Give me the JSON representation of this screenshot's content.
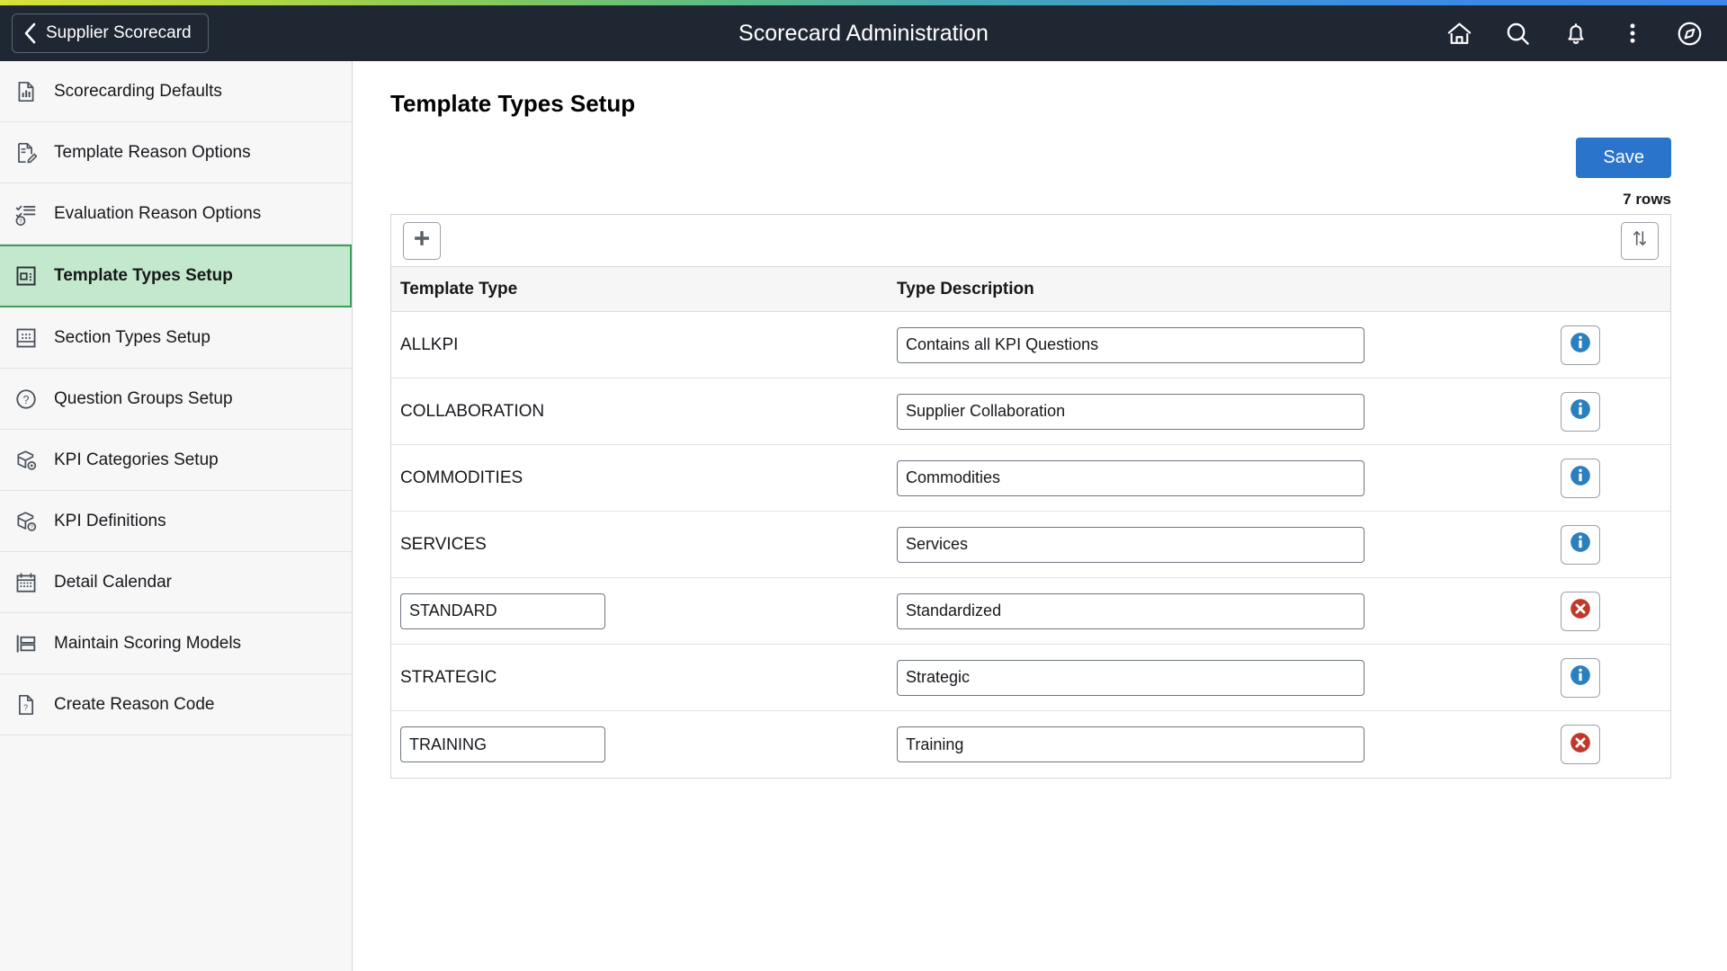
{
  "top_strip": {
    "gradient_from": "#d8e23a",
    "gradient_to": "#3f86ea"
  },
  "header": {
    "back_label": "Supplier Scorecard",
    "title": "Scorecard Administration",
    "background": "#1f2733",
    "icons": [
      {
        "name": "home-icon"
      },
      {
        "name": "search-icon"
      },
      {
        "name": "notifications-bell-icon"
      },
      {
        "name": "actions-menu-icon"
      },
      {
        "name": "navigator-compass-icon"
      }
    ]
  },
  "sidebar": {
    "selected_index": 3,
    "selected_background": "#c4e8cd",
    "selected_border": "#3f9e5c",
    "items": [
      {
        "label": "Scorecarding Defaults",
        "icon": "document-chart-icon"
      },
      {
        "label": "Template Reason Options",
        "icon": "document-edit-icon"
      },
      {
        "label": "Evaluation Reason Options",
        "icon": "checklist-question-icon"
      },
      {
        "label": "Template Types Setup",
        "icon": "template-grid-icon"
      },
      {
        "label": "Section Types Setup",
        "icon": "section-dots-icon"
      },
      {
        "label": "Question Groups Setup",
        "icon": "question-circle-icon"
      },
      {
        "label": "KPI Categories Setup",
        "icon": "cube-gear-icon"
      },
      {
        "label": "KPI Definitions",
        "icon": "cube-question-icon"
      },
      {
        "label": "Detail Calendar",
        "icon": "calendar-icon"
      },
      {
        "label": "Maintain Scoring Models",
        "icon": "scoring-model-icon"
      },
      {
        "label": "Create Reason Code",
        "icon": "document-question-icon"
      }
    ]
  },
  "main": {
    "page_title": "Template Types Setup",
    "save_label": "Save",
    "save_color": "#2a74cc",
    "rows_count_label": "7 rows",
    "toolbar": {
      "add_row_icon": "plus-icon",
      "sort_icon": "sort-arrows-icon"
    },
    "grid": {
      "columns": [
        {
          "key": "template_type",
          "label": "Template Type"
        },
        {
          "key": "type_description",
          "label": "Type Description"
        }
      ],
      "info_color": "#2a7fbf",
      "delete_color": "#c0392b",
      "rows": [
        {
          "template_type": "ALLKPI",
          "type_editable": false,
          "type_description": "Contains all KPI Questions",
          "action": "info",
          "action_icon": "info-icon"
        },
        {
          "template_type": "COLLABORATION",
          "type_editable": false,
          "type_description": "Supplier Collaboration",
          "action": "info",
          "action_icon": "info-icon"
        },
        {
          "template_type": "COMMODITIES",
          "type_editable": false,
          "type_description": "Commodities",
          "action": "info",
          "action_icon": "info-icon"
        },
        {
          "template_type": "SERVICES",
          "type_editable": false,
          "type_description": "Services",
          "action": "info",
          "action_icon": "info-icon"
        },
        {
          "template_type": "STANDARD",
          "type_editable": true,
          "type_description": "Standardized",
          "action": "delete",
          "action_icon": "delete-icon"
        },
        {
          "template_type": "STRATEGIC",
          "type_editable": false,
          "type_description": "Strategic",
          "action": "info",
          "action_icon": "info-icon"
        },
        {
          "template_type": "TRAINING",
          "type_editable": true,
          "type_description": "Training",
          "action": "delete",
          "action_icon": "delete-icon"
        }
      ]
    }
  }
}
